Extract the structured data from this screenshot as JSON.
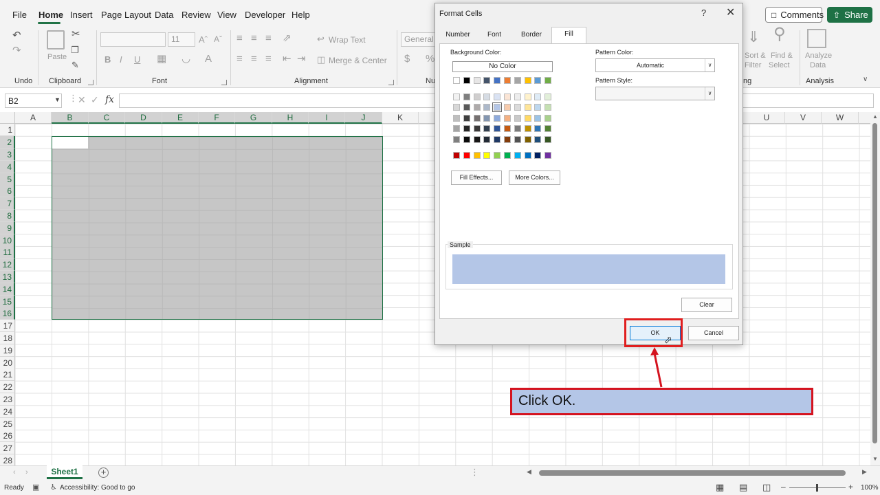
{
  "menu": {
    "items": [
      "File",
      "Home",
      "Insert",
      "Page Layout",
      "Data",
      "Review",
      "View",
      "Developer",
      "Help"
    ],
    "comments": "Comments",
    "share": "Share"
  },
  "ribbon": {
    "groups": {
      "undo": "Undo",
      "clipboard": "Clipboard",
      "font": "Font",
      "alignment": "Alignment",
      "number_partial": "Nu",
      "editing_partial": "ng",
      "analysis": "Analysis"
    },
    "paste": "Paste",
    "font_size": "11",
    "wrap_text": "Wrap Text",
    "merge_center": "Merge & Center",
    "number_format": "General",
    "sort_filter_1": "Sort &",
    "sort_filter_2": "Filter",
    "find_select_1": "Find &",
    "find_select_2": "Select",
    "analyze_1": "Analyze",
    "analyze_2": "Data",
    "bold": "B",
    "italic": "I",
    "underline": "U"
  },
  "formula_bar": {
    "name_box": "B2",
    "fx": "fx"
  },
  "grid": {
    "columns": [
      "A",
      "B",
      "C",
      "D",
      "E",
      "F",
      "G",
      "H",
      "I",
      "J",
      "K",
      "U",
      "V",
      "W"
    ],
    "rows": [
      "1",
      "2",
      "3",
      "4",
      "5",
      "6",
      "7",
      "8",
      "9",
      "10",
      "11",
      "12",
      "13",
      "14",
      "15",
      "16",
      "17",
      "18",
      "19",
      "20",
      "21",
      "22",
      "23",
      "24",
      "25",
      "26",
      "27",
      "28"
    ]
  },
  "sheets": {
    "active": "Sheet1"
  },
  "status": {
    "ready": "Ready",
    "accessibility": "Accessibility: Good to go",
    "zoom": "100%"
  },
  "dialog": {
    "title": "Format Cells",
    "help": "?",
    "tabs": [
      "Number",
      "Font",
      "Border",
      "Fill"
    ],
    "active_tab": "Fill",
    "background_color_label": "Background Color:",
    "no_color": "No Color",
    "fill_effects": "Fill Effects...",
    "more_colors": "More Colors...",
    "pattern_color_label": "Pattern Color:",
    "pattern_color_value": "Automatic",
    "pattern_style_label": "Pattern Style:",
    "pattern_style_value": "",
    "sample_label": "Sample",
    "sample_color": "#B4C6E7",
    "clear": "Clear",
    "ok": "OK",
    "cancel": "Cancel",
    "theme_colors_top": [
      "#FFFFFF",
      "#000000",
      "#E7E6E6",
      "#44546A",
      "#4472C4",
      "#ED7D31",
      "#A5A5A5",
      "#FFC000",
      "#5B9BD5",
      "#70AD47"
    ],
    "theme_tints": [
      [
        "#F2F2F2",
        "#7F7F7F",
        "#D0CECE",
        "#D6DCE4",
        "#D9E2F3",
        "#FBE5D5",
        "#EDEDED",
        "#FFF2CC",
        "#DEEBF6",
        "#E2EFD9"
      ],
      [
        "#D8D8D8",
        "#595959",
        "#AEAAAA",
        "#ADB9CA",
        "#B4C6E7",
        "#F7CBAC",
        "#DBDBDB",
        "#FEE599",
        "#BDD7EE",
        "#C5E0B3"
      ],
      [
        "#BFBFBF",
        "#3F3F3F",
        "#757070",
        "#8496B0",
        "#8EAADB",
        "#F4B183",
        "#C9C9C9",
        "#FFD965",
        "#9CC3E5",
        "#A8D08D"
      ],
      [
        "#A5A5A5",
        "#262626",
        "#3A3838",
        "#323F4F",
        "#2F5496",
        "#C55A11",
        "#7B7B7B",
        "#BF9000",
        "#2E75B5",
        "#538135"
      ],
      [
        "#7F7F7F",
        "#0C0C0C",
        "#171616",
        "#222A35",
        "#1F3864",
        "#833C0B",
        "#525252",
        "#7F6000",
        "#1E4E79",
        "#375623"
      ]
    ],
    "standard_colors": [
      "#C00000",
      "#FF0000",
      "#FFC000",
      "#FFFF00",
      "#92D050",
      "#00B050",
      "#00B0F0",
      "#0070C0",
      "#002060",
      "#7030A0"
    ]
  },
  "callout": {
    "text": "Click OK."
  }
}
